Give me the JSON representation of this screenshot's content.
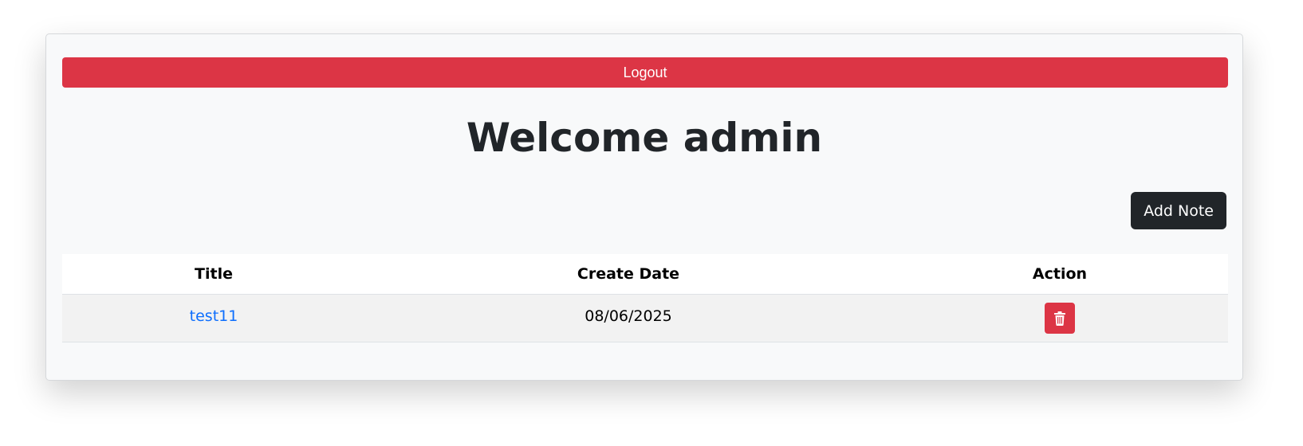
{
  "header": {
    "logout_label": "Logout"
  },
  "main": {
    "title": "Welcome admin",
    "add_note_label": "Add Note"
  },
  "table": {
    "columns": [
      "Title",
      "Create Date",
      "Action"
    ],
    "rows": [
      {
        "title": "test11",
        "create_date": "08/06/2025",
        "action_icon": "trash-icon"
      }
    ]
  },
  "colors": {
    "danger": "#dc3545",
    "dark": "#212529",
    "link": "#0d6efd",
    "card_bg": "#f8f9fa",
    "row_bg": "#f2f2f2"
  }
}
